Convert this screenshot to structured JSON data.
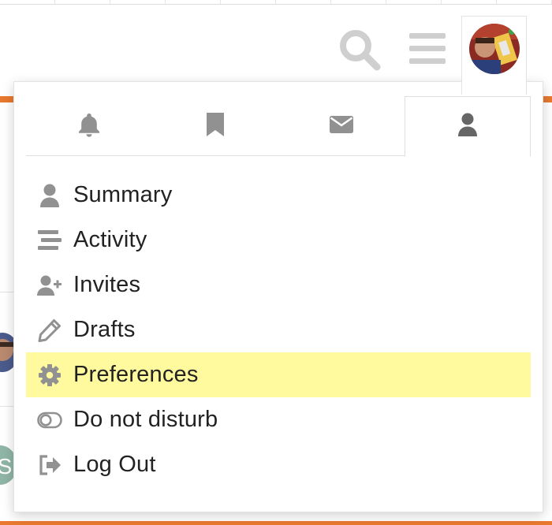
{
  "header": {
    "search_icon": "search-icon",
    "menu_icon": "hamburger-menu-icon",
    "avatar_icon": "user-avatar"
  },
  "panel": {
    "tabs": [
      {
        "icon": "bell-icon"
      },
      {
        "icon": "bookmark-icon"
      },
      {
        "icon": "envelope-icon"
      },
      {
        "icon": "user-icon",
        "active": true
      }
    ],
    "menu": [
      {
        "label": "Summary",
        "icon": "user-icon"
      },
      {
        "label": "Activity",
        "icon": "stream-icon"
      },
      {
        "label": "Invites",
        "icon": "user-plus-icon"
      },
      {
        "label": "Drafts",
        "icon": "pencil-icon"
      },
      {
        "label": "Preferences",
        "icon": "gear-icon",
        "highlighted": true
      },
      {
        "label": "Do not disturb",
        "icon": "toggle-off-icon"
      },
      {
        "label": "Log Out",
        "icon": "sign-out-icon"
      }
    ]
  },
  "colors": {
    "accent": "#e8792f",
    "highlight": "#fffa9e",
    "icon": "#919191",
    "icon_dark": "#666666",
    "text": "#222222"
  }
}
